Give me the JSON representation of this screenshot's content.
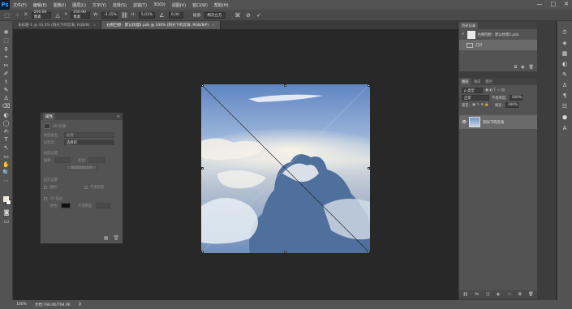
{
  "menubar": {
    "logo": "Ps",
    "items": [
      "文件(F)",
      "编辑(E)",
      "图像(I)",
      "图层(L)",
      "文字(Y)",
      "选择(S)",
      "滤镜(T)",
      "3D(D)",
      "视图(V)",
      "窗口(W)",
      "帮助(H)"
    ],
    "window_controls": [
      "—",
      "□",
      "✕"
    ]
  },
  "options_bar": {
    "x_label": "X:",
    "x_value": "256.00 像素",
    "y_label": "Y:",
    "y_value": "256.00 像素",
    "w_label": "W:",
    "w_value": "-3.35%",
    "h_label": "H:",
    "h_value": "5.01%",
    "angle_value": "0.00",
    "interp_label": "插值:",
    "interp_value": "两次立方"
  },
  "tabs": [
    {
      "label": "未标题-1 @ 33.3% (阳光下的云海, RGB/8)",
      "active": false
    },
    {
      "label": "右侧回想 - 默认纹理2.psb @ 100% (阳光下的云海, RGB/8#)",
      "active": true
    }
  ],
  "tools": [
    "✥",
    "⬚",
    "ϙ",
    "⌖",
    "✂",
    "✐",
    "⚕",
    "✎",
    "♙",
    "⌫",
    "◐",
    "◯",
    "✍",
    "T",
    "↖",
    "▭",
    "✋",
    "🔍",
    "⋯"
  ],
  "properties": {
    "tab": "属性",
    "title": "3D 光源",
    "row1_label": "贴图类型:",
    "row1_value": "纹理",
    "row2_label": "投影到:",
    "row2_value": "选择的",
    "section2": "贴图设置",
    "offset_label": "偏移:",
    "repeat_label": "重复:",
    "btn_label": "编辑贴图比例",
    "section3": "显示设置",
    "check1": "透明",
    "check2": "不透明度",
    "section4": "3D 描边",
    "color_label": "颜色:",
    "opacity_label": "不透明度:"
  },
  "history": {
    "tab": "历史记录",
    "item1": "右侧回想 - 默认纹理2.psb",
    "item2": "打开"
  },
  "layers": {
    "tabs": [
      "图层",
      "通道",
      "路径"
    ],
    "search_label": "ρ 类型",
    "blend_mode": "正常",
    "opacity_label": "不透明度:",
    "opacity_value": "100%",
    "lock_label": "锁定:",
    "fill_label": "填充:",
    "fill_value": "100%",
    "layer_name": "阳光下的云海"
  },
  "status": {
    "zoom": "100%",
    "doc": "文档:768.0K/768.0K"
  }
}
